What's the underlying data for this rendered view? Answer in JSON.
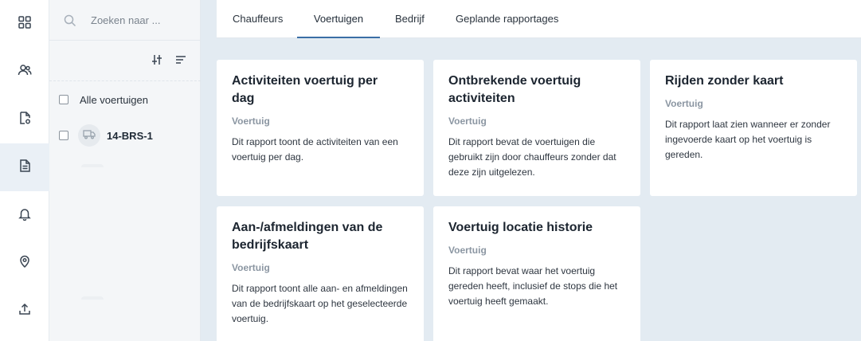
{
  "rail": {
    "items": [
      {
        "icon": "dashboard-icon"
      },
      {
        "icon": "users-icon"
      },
      {
        "icon": "document-settings-icon"
      },
      {
        "icon": "report-icon",
        "active": true
      },
      {
        "icon": "bell-icon"
      },
      {
        "icon": "location-icon"
      },
      {
        "icon": "upload-icon"
      }
    ]
  },
  "filter_panel": {
    "search": {
      "placeholder": "Zoeken naar ..."
    },
    "all_vehicles_label": "Alle voertuigen",
    "vehicles": [
      {
        "plate": "14-BRS-1"
      }
    ]
  },
  "tabs": [
    {
      "label": "Chauffeurs",
      "active": false
    },
    {
      "label": "Voertuigen",
      "active": true
    },
    {
      "label": "Bedrijf",
      "active": false
    },
    {
      "label": "Geplande rapportages",
      "active": false
    }
  ],
  "cards": [
    {
      "title": "Activiteiten voertuig per dag",
      "category": "Voertuig",
      "description": "Dit rapport toont de activiteiten van een voertuig per dag."
    },
    {
      "title": "Ontbrekende voertuig activiteiten",
      "category": "Voertuig",
      "description": "Dit rapport bevat de voertuigen die gebruikt zijn door chauffeurs zonder dat deze zijn uitgelezen."
    },
    {
      "title": "Rijden zonder kaart",
      "category": "Voertuig",
      "description": "Dit rapport laat zien wanneer er zonder ingevoerde kaart op het voertuig is gereden."
    },
    {
      "title": "Aan-/afmeldingen van de bedrijfskaart",
      "category": "Voertuig",
      "description": "Dit rapport toont alle aan- en afmeldingen van de bedrijfskaart op het geselecteerde voertuig."
    },
    {
      "title": "Voertuig locatie historie",
      "category": "Voertuig",
      "description": "Dit rapport bevat waar het voertuig gereden heeft, inclusief de stops die het voertuig heeft gemaakt."
    }
  ]
}
